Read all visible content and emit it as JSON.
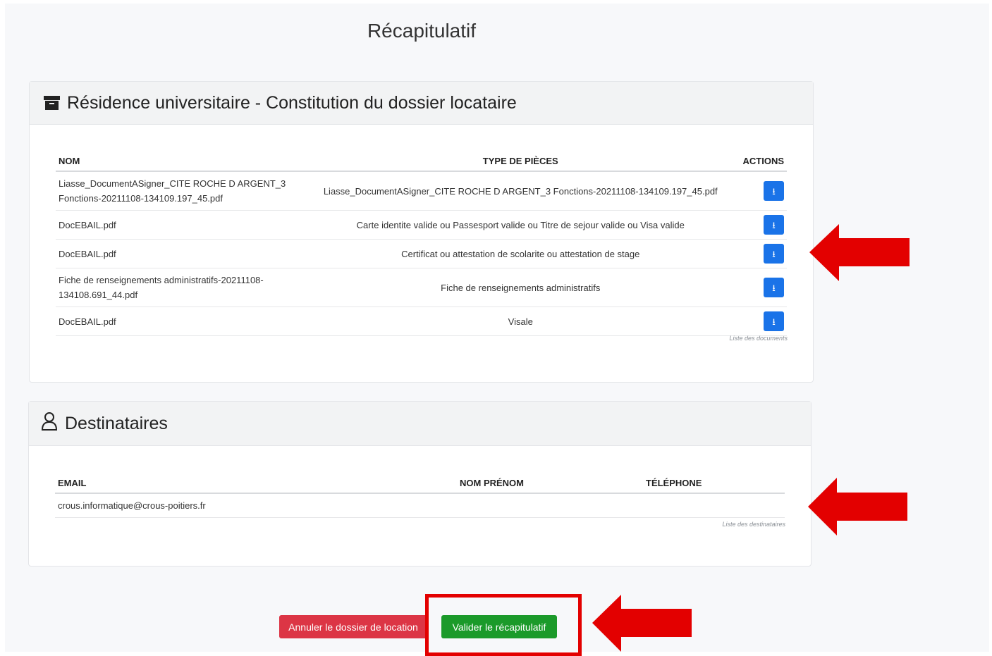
{
  "page": {
    "title": "Récapitulatif"
  },
  "documents_card": {
    "title": "Résidence universitaire - Constitution du dossier locataire",
    "icon": "archive-icon",
    "columns": {
      "name": "NOM",
      "type": "TYPE DE PIÈCES",
      "actions": "ACTIONS"
    },
    "rows": [
      {
        "name": "Liasse_DocumentASigner_CITE ROCHE D ARGENT_3 Fonctions-20211108-134109.197_45.pdf",
        "type": "Liasse_DocumentASigner_CITE ROCHE D ARGENT_3 Fonctions-20211108-134109.197_45.pdf",
        "action_icon": "download-icon"
      },
      {
        "name": "DocEBAIL.pdf",
        "type": "Carte identite valide ou Passesport valide ou Titre de sejour valide ou Visa valide",
        "action_icon": "download-icon"
      },
      {
        "name": "DocEBAIL.pdf",
        "type": "Certificat ou attestation de scolarite ou attestation de stage",
        "action_icon": "download-icon"
      },
      {
        "name": "Fiche de renseignements administratifs-20211108-134108.691_44.pdf",
        "type": "Fiche de renseignements administratifs",
        "action_icon": "download-icon"
      },
      {
        "name": "DocEBAIL.pdf",
        "type": "Visale",
        "action_icon": "download-icon"
      }
    ],
    "caption": "Liste des documents"
  },
  "recipients_card": {
    "title": "Destinataires",
    "icon": "user-icon",
    "columns": {
      "email": "EMAIL",
      "name": "NOM PRÉNOM",
      "phone": "TÉLÉPHONE"
    },
    "rows": [
      {
        "email": "crous.informatique@crous-poitiers.fr",
        "name": "",
        "phone": ""
      }
    ],
    "caption": "Liste des destinataires"
  },
  "actions": {
    "cancel_label": "Annuler le dossier de location",
    "validate_label": "Valider le récapitulatif"
  },
  "colors": {
    "primary": "#1a73e8",
    "danger": "#dc3545",
    "success": "#1b9a2a",
    "annotation": "#e30000"
  }
}
